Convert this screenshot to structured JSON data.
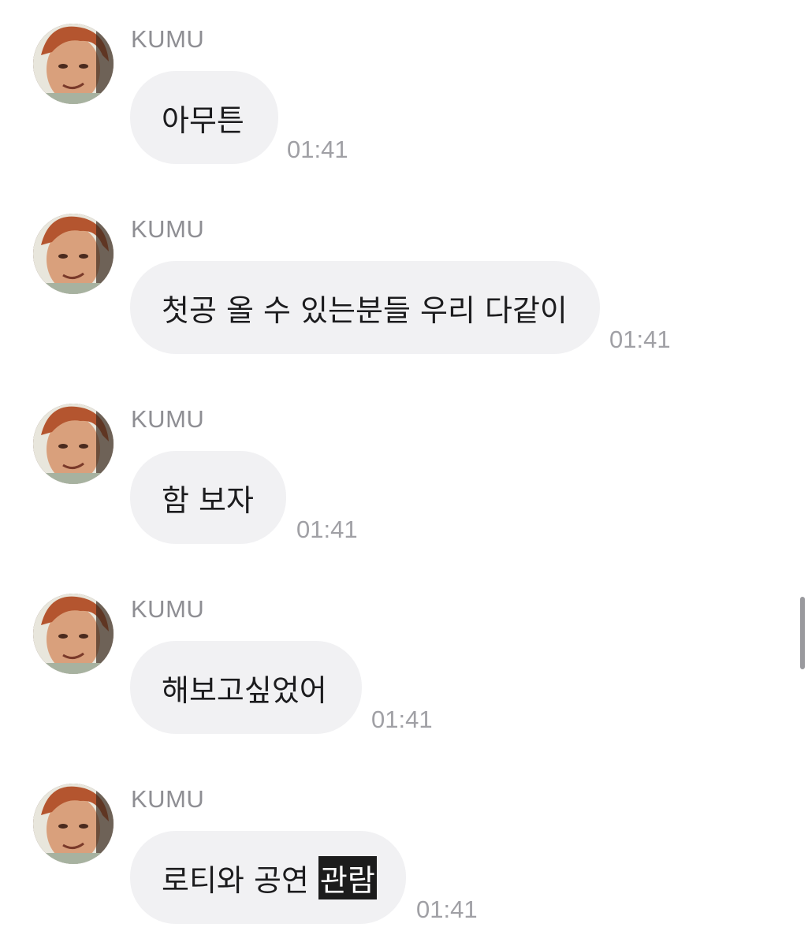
{
  "messages": [
    {
      "sender": "KUMU",
      "text": "아무튼",
      "time": "01:41"
    },
    {
      "sender": "KUMU",
      "text": "첫공 올 수 있는분들 우리 다같이",
      "time": "01:41"
    },
    {
      "sender": "KUMU",
      "text": "함 보자",
      "time": "01:41"
    },
    {
      "sender": "KUMU",
      "text": "해보고싶었어",
      "time": "01:41"
    },
    {
      "sender": "KUMU",
      "text": "로티와 공연",
      "highlighted_text": "관람",
      "time": "01:41"
    }
  ],
  "icons": {
    "avatar": "profile-photo"
  },
  "colors": {
    "bubble": "#f1f1f3",
    "sender": "#8e8e93",
    "time": "#a0a0a5",
    "text": "#1c1c1e",
    "highlight_bg": "#1c1c1c"
  }
}
